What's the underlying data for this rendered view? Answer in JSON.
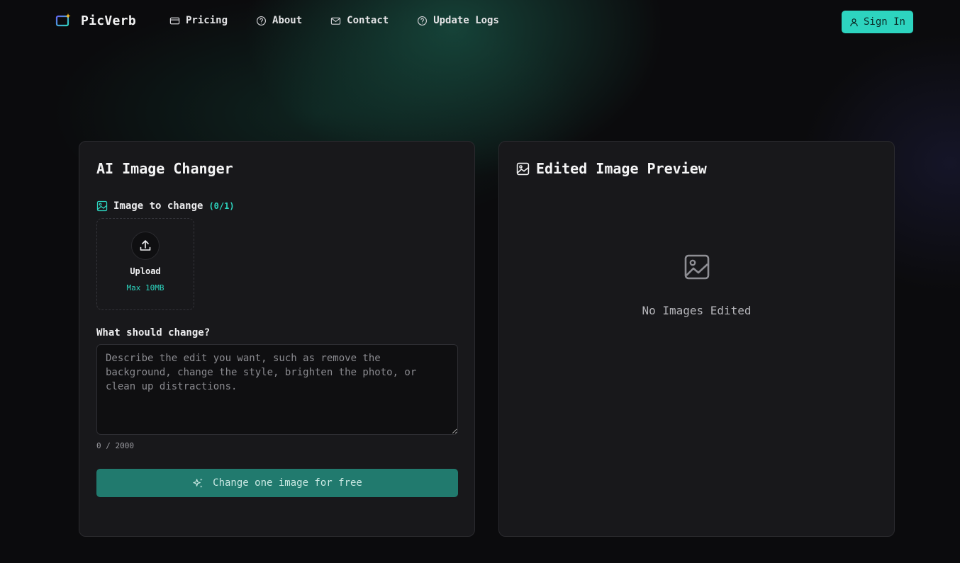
{
  "brand": {
    "name": "PicVerb"
  },
  "nav": {
    "items": [
      {
        "label": "Pricing",
        "icon": "card-icon"
      },
      {
        "label": "About",
        "icon": "help-circle-icon"
      },
      {
        "label": "Contact",
        "icon": "mail-icon"
      },
      {
        "label": "Update Logs",
        "icon": "help-circle-icon"
      }
    ],
    "sign_in": "Sign In"
  },
  "editor": {
    "title": "AI Image Changer",
    "image_label": "Image to change",
    "image_count": "(0/1)",
    "upload_label": "Upload",
    "upload_max": "Max 10MB",
    "prompt_label": "What should change?",
    "prompt_value": "",
    "prompt_placeholder": "Describe the edit you want, such as remove the background, change the style, brighten the photo, or clean up distractions.",
    "char_count": "0 / 2000",
    "submit_label": "Change one image for free"
  },
  "preview": {
    "title": "Edited Image Preview",
    "empty_text": "No Images Edited"
  },
  "colors": {
    "accent": "#2dd4bf",
    "button_bg": "#217a6e",
    "card_bg": "#18181b",
    "page_bg": "#0b0b0d"
  }
}
